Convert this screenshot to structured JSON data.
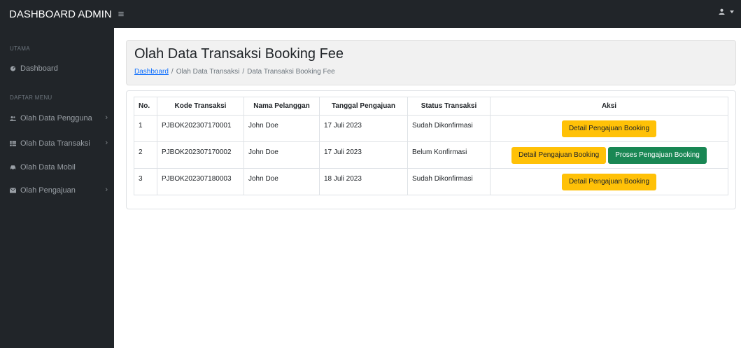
{
  "topbar": {
    "brand": "DASHBOARD ADMIN",
    "toggle_icon": "bars-icon",
    "user_icon": "user-icon"
  },
  "sidebar": {
    "section_main": "UTAMA",
    "section_menu": "DAFTAR MENU",
    "items": [
      {
        "label": "Dashboard",
        "icon": "gauge-icon"
      },
      {
        "label": "Olah Data Pengguna",
        "icon": "users-icon",
        "has_chevron": true
      },
      {
        "label": "Olah Data Transaksi",
        "icon": "table-icon",
        "has_chevron": true
      },
      {
        "label": "Olah Data Mobil",
        "icon": "car-icon"
      },
      {
        "label": "Olah Pengajuan",
        "icon": "envelope-icon",
        "has_chevron": true
      }
    ]
  },
  "header": {
    "title": "Olah Data Transaksi Booking Fee",
    "breadcrumb": [
      "Dashboard",
      "Olah Data Transaksi",
      "Data Transaksi Booking Fee"
    ],
    "breadcrumb_sep": "/"
  },
  "table": {
    "columns": [
      "No.",
      "Kode Transaksi",
      "Nama Pelanggan",
      "Tanggal Pengajuan",
      "Status Transaksi",
      "Aksi"
    ],
    "rows": [
      {
        "no": "1",
        "kode": "PJBOK202307170001",
        "nama": "John Doe",
        "tanggal": "17 Juli 2023",
        "status": "Sudah Dikonfirmasi"
      },
      {
        "no": "2",
        "kode": "PJBOK202307170002",
        "nama": "John Doe",
        "tanggal": "17 Juli 2023",
        "status": "Belum Konfirmasi"
      },
      {
        "no": "3",
        "kode": "PJBOK202307180003",
        "nama": "John Doe",
        "tanggal": "18 Juli 2023",
        "status": "Sudah Dikonfirmasi"
      }
    ],
    "detail_label": "Detail Pengajuan Booking",
    "proses_label": "Proses Pengajuan Booking"
  },
  "colors": {
    "sidebar_bg": "#212529",
    "warning": "#ffc107",
    "success": "#198754",
    "link": "#0d6efd"
  }
}
